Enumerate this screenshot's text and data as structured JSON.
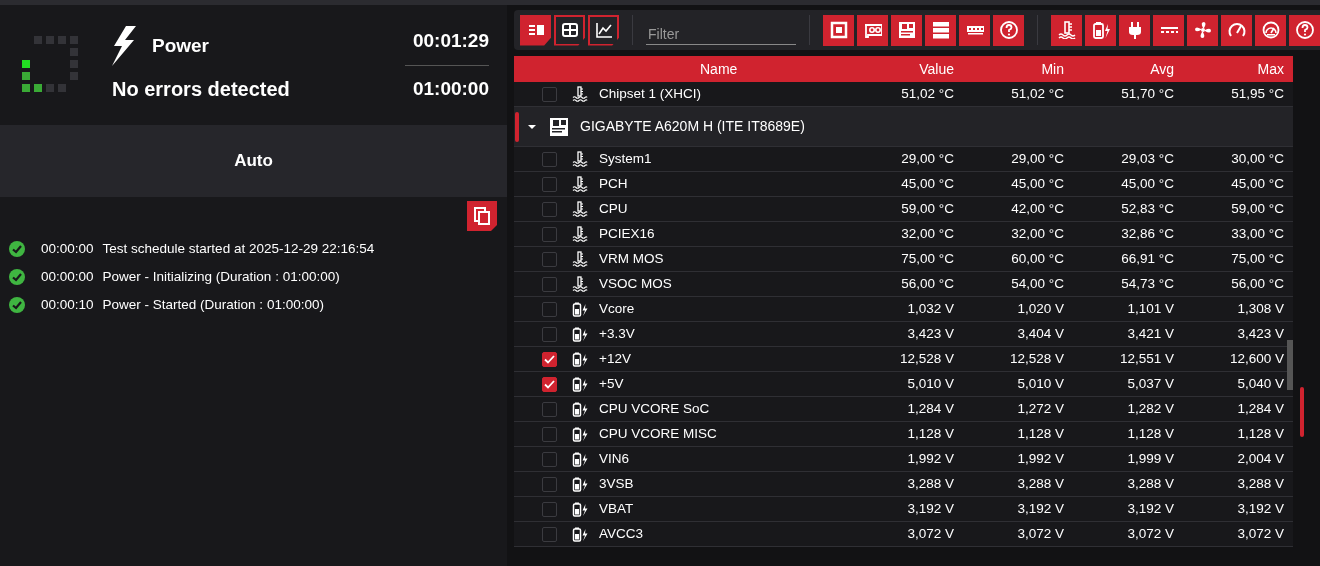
{
  "status": {
    "title": "Power",
    "message": "No errors detected",
    "elapsed": "00:01:29",
    "duration": "01:00:00"
  },
  "mode": {
    "label": "Auto"
  },
  "log": [
    {
      "kind": "ok",
      "time": "00:00:00",
      "text": "Test schedule started at 2025-12-29 22:16:54"
    },
    {
      "kind": "ok",
      "time": "00:00:00",
      "text": "Power - Initializing (Duration : 01:00:00)"
    },
    {
      "kind": "ok",
      "time": "00:00:10",
      "text": "Power - Started (Duration : 01:00:00)"
    }
  ],
  "toolbar": {
    "view_buttons": [
      {
        "kind": "list",
        "selected": true
      },
      {
        "kind": "grid",
        "selected": false
      },
      {
        "kind": "chart",
        "selected": false
      }
    ],
    "filter": {
      "placeholder": "Filter"
    }
  },
  "table": {
    "columns": [
      "Name",
      "Value",
      "Min",
      "Avg",
      "Max"
    ],
    "rows": [
      {
        "kind": "temperature",
        "checked": false,
        "name": "Chipset 1 (XHCI)",
        "value": "51,02 °C",
        "min": "51,02 °C",
        "avg": "51,70 °C",
        "max": "51,95 °C"
      },
      {
        "kind": "group",
        "expanded": true,
        "name": "GIGABYTE A620M H (ITE IT8689E)"
      },
      {
        "kind": "temperature",
        "checked": false,
        "name": "System1",
        "value": "29,00 °C",
        "min": "29,00 °C",
        "avg": "29,03 °C",
        "max": "30,00 °C"
      },
      {
        "kind": "temperature",
        "checked": false,
        "name": "PCH",
        "value": "45,00 °C",
        "min": "45,00 °C",
        "avg": "45,00 °C",
        "max": "45,00 °C"
      },
      {
        "kind": "temperature",
        "checked": false,
        "name": "CPU",
        "value": "59,00 °C",
        "min": "42,00 °C",
        "avg": "52,83 °C",
        "max": "59,00 °C"
      },
      {
        "kind": "temperature",
        "checked": false,
        "name": "PCIEX16",
        "value": "32,00 °C",
        "min": "32,00 °C",
        "avg": "32,86 °C",
        "max": "33,00 °C"
      },
      {
        "kind": "temperature",
        "checked": false,
        "name": "VRM MOS",
        "value": "75,00 °C",
        "min": "60,00 °C",
        "avg": "66,91 °C",
        "max": "75,00 °C"
      },
      {
        "kind": "temperature",
        "checked": false,
        "name": "VSOC MOS",
        "value": "56,00 °C",
        "min": "54,00 °C",
        "avg": "54,73 °C",
        "max": "56,00 °C"
      },
      {
        "kind": "voltage",
        "checked": false,
        "name": "Vcore",
        "value": "1,032 V",
        "min": "1,020 V",
        "avg": "1,101 V",
        "max": "1,308 V"
      },
      {
        "kind": "voltage",
        "checked": false,
        "name": "+3.3V",
        "value": "3,423 V",
        "min": "3,404 V",
        "avg": "3,421 V",
        "max": "3,423 V"
      },
      {
        "kind": "voltage",
        "checked": true,
        "name": "+12V",
        "value": "12,528 V",
        "min": "12,528 V",
        "avg": "12,551 V",
        "max": "12,600 V"
      },
      {
        "kind": "voltage",
        "checked": true,
        "name": "+5V",
        "value": "5,010 V",
        "min": "5,010 V",
        "avg": "5,037 V",
        "max": "5,040 V"
      },
      {
        "kind": "voltage",
        "checked": false,
        "name": "CPU VCORE SoC",
        "value": "1,284 V",
        "min": "1,272 V",
        "avg": "1,282 V",
        "max": "1,284 V"
      },
      {
        "kind": "voltage",
        "checked": false,
        "name": "CPU VCORE MISC",
        "value": "1,128 V",
        "min": "1,128 V",
        "avg": "1,128 V",
        "max": "1,128 V"
      },
      {
        "kind": "voltage",
        "checked": false,
        "name": "VIN6",
        "value": "1,992 V",
        "min": "1,992 V",
        "avg": "1,999 V",
        "max": "2,004 V"
      },
      {
        "kind": "voltage",
        "checked": false,
        "name": "3VSB",
        "value": "3,288 V",
        "min": "3,288 V",
        "avg": "3,288 V",
        "max": "3,288 V"
      },
      {
        "kind": "voltage",
        "checked": false,
        "name": "VBAT",
        "value": "3,192 V",
        "min": "3,192 V",
        "avg": "3,192 V",
        "max": "3,192 V"
      },
      {
        "kind": "voltage",
        "checked": false,
        "name": "AVCC3",
        "value": "3,072 V",
        "min": "3,072 V",
        "avg": "3,072 V",
        "max": "3,072 V"
      }
    ]
  }
}
